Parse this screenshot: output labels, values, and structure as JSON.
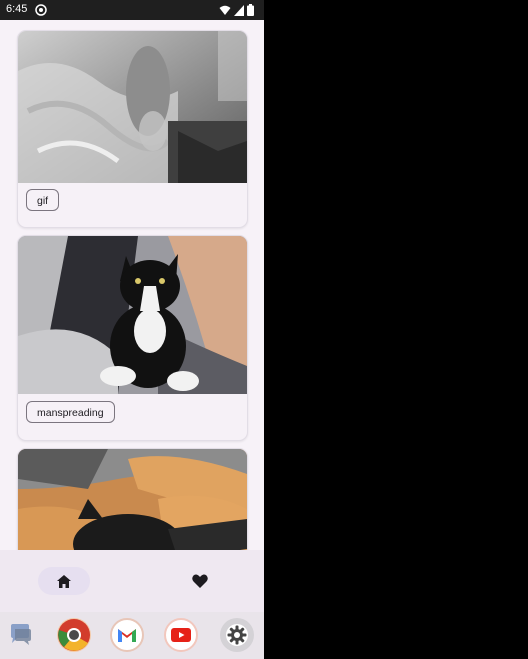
{
  "status_bar": {
    "time": "6:45",
    "icons": [
      "notification-icon",
      "wifi-icon",
      "signal-icon",
      "battery-icon"
    ]
  },
  "feed": {
    "cards": [
      {
        "tag": "gif",
        "image": "gif-photo"
      },
      {
        "tag": "manspreading",
        "image": "tuxedo-cat-photo"
      },
      {
        "tag": "",
        "image": "black-cat-on-blanket-photo"
      }
    ]
  },
  "bottom_nav": {
    "items": [
      {
        "icon": "home-icon",
        "selected": true
      },
      {
        "icon": "heart-icon",
        "selected": false
      }
    ],
    "accent": "#e6dff0"
  },
  "dock": {
    "apps": [
      "messages-icon",
      "chrome-icon",
      "gmail-icon",
      "youtube-icon",
      "settings-icon"
    ]
  }
}
